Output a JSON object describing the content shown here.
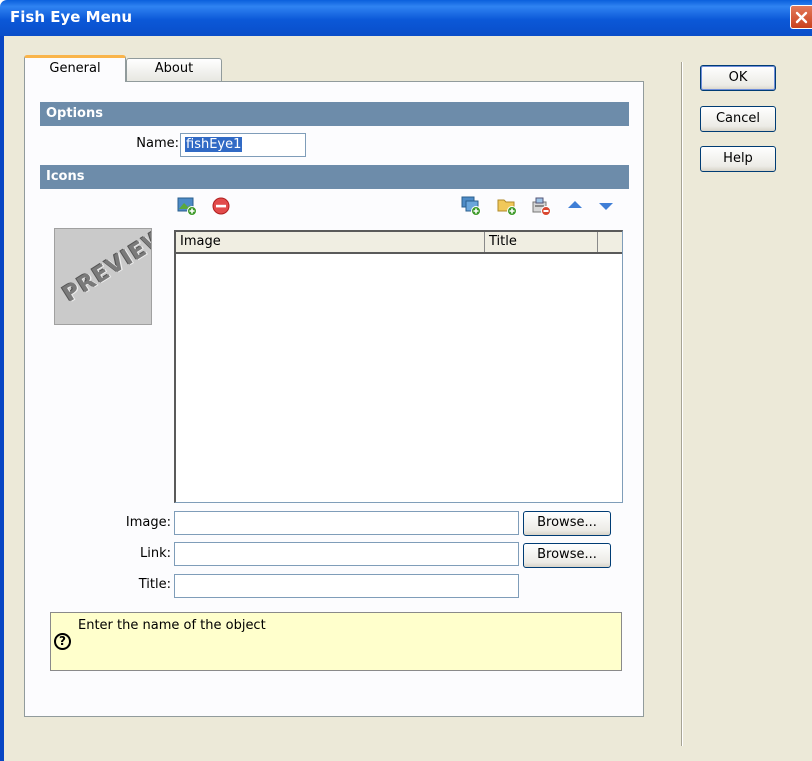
{
  "window": {
    "title": "Fish Eye Menu"
  },
  "tabs": [
    {
      "label": "General"
    },
    {
      "label": "About"
    }
  ],
  "options": {
    "header": "Options",
    "name_label": "Name:",
    "name_value": "fishEye1"
  },
  "icons": {
    "header": "Icons",
    "preview_text": "PREVIEW",
    "toolbar": [
      "add-image-icon",
      "remove-icon",
      "add-images-icon",
      "add-folder-icon",
      "edit-icon",
      "move-up-icon",
      "move-down-icon"
    ],
    "columns": [
      "Image",
      "Title"
    ],
    "rows": []
  },
  "fields": {
    "image_label": "Image:",
    "image_value": "",
    "link_label": "Link:",
    "link_value": "",
    "title_label": "Title:",
    "title_value": "",
    "browse_label": "Browse..."
  },
  "help": {
    "text": "Enter the name of the object",
    "icon": "?"
  },
  "buttons": {
    "ok": "OK",
    "cancel": "Cancel",
    "help": "Help"
  },
  "colors": {
    "accent": "#6d8caa",
    "help_bg": "#ffffcc",
    "titlebar": "#0a5fdc"
  }
}
